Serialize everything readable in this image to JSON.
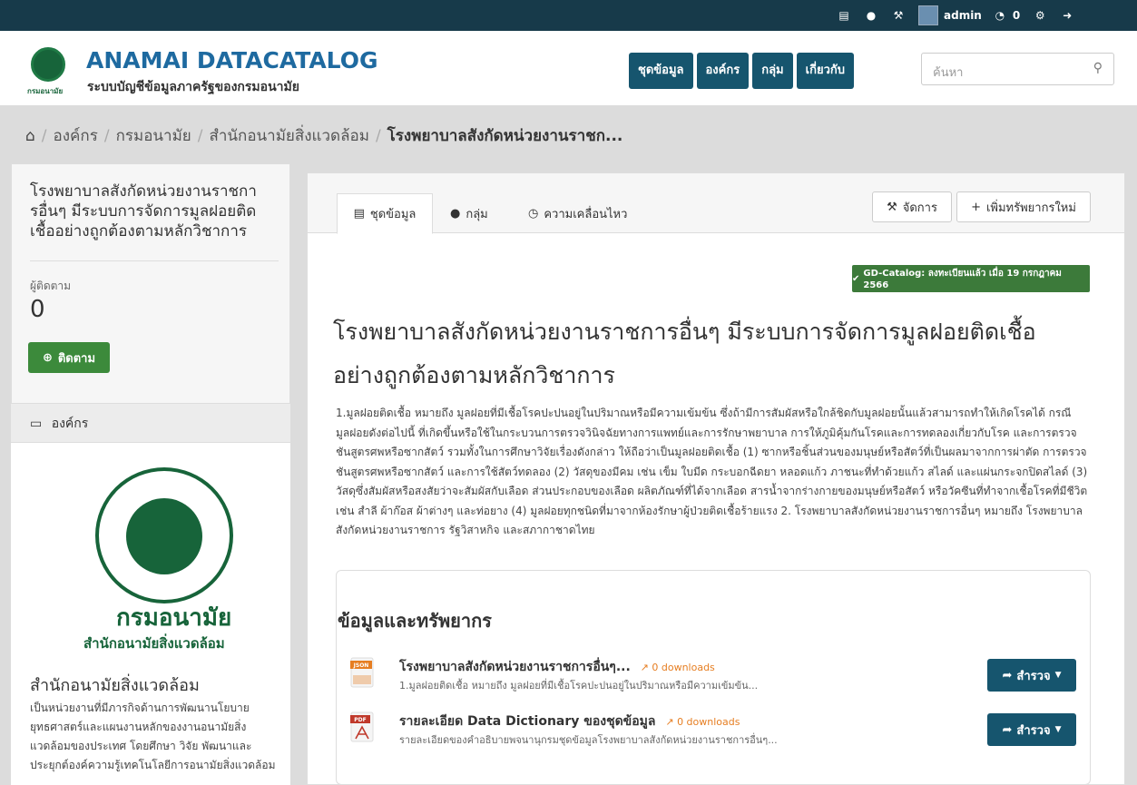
{
  "topbar": {
    "username": "admin",
    "dashboard_count": "0"
  },
  "site": {
    "title": "ANAMAI DATACATALOG",
    "subtitle": "ระบบบัญชีข้อมูลภาครัฐของกรมอนามัย",
    "logo_text": "กรมอนามัย"
  },
  "nav": {
    "items": [
      "ชุดข้อมูล",
      "องค์กร",
      "กลุ่ม",
      "เกี่ยวกับ"
    ]
  },
  "search": {
    "placeholder": "ค้นหา"
  },
  "breadcrumb": {
    "items": [
      "องค์กร",
      "กรมอนามัย",
      "สำนักอนามัยสิ่งแวดล้อม",
      "โรงพยาบาลสังกัดหน่วยงานราชก..."
    ]
  },
  "sidebar": {
    "title": "โรงพยาบาลสังกัดหน่วยงานราชการอื่นๆ มีระบบการจัดการมูลฝอยติดเชื้ออย่างถูกต้องตามหลักวิชาการ",
    "followers_label": "ผู้ติดตาม",
    "followers_count": "0",
    "follow_button": "ติดตาม",
    "org_header": "องค์กร",
    "org_logo_big": "กรมอนามัย",
    "org_logo_sub": "สำนักอนามัยสิ่งแวดล้อม",
    "org_name": "สำนักอนามัยสิ่งแวดล้อม",
    "org_description": "เป็นหน่วยงานที่มีภารกิจด้านการพัฒนานโยบาย ยุทธศาสตร์และแผนงานหลักของงานอนามัยสิ่งแวดล้อมของประเทศ โดยศึกษา วิจัย พัฒนาและประยุกต์องค์ความรู้เทคโนโลยีการอนามัยสิ่งแวดล้อม"
  },
  "tabs": {
    "dataset": "ชุดข้อมูล",
    "groups": "กลุ่ม",
    "activity": "ความเคลื่อนไหว"
  },
  "actions": {
    "manage": "จัดการ",
    "add_resource": "เพิ่มทรัพยากรใหม่"
  },
  "badge": "GD-Catalog: ลงทะเบียนแล้ว เมื่อ 19 กรกฎาคม 2566",
  "dataset": {
    "title": "โรงพยาบาลสังกัดหน่วยงานราชการอื่นๆ มีระบบการจัดการมูลฝอยติดเชื้ออย่างถูกต้องตามหลักวิชาการ",
    "notes": "1.มูลฝอยติดเชื้อ หมายถึง มูลฝอยที่มีเชื้อโรคปะปนอยู่ในปริมาณหรือมีความเข้มข้น ซึ่งถ้ามีการสัมผัสหรือใกล้ชิดกับมูลฝอยนั้นแล้วสามารถทำให้เกิดโรคได้ กรณีมูลฝอยดังต่อไปนี้ ที่เกิดขึ้นหรือใช้ในกระบวนการตรวจวินิจฉัยทางการแพทย์และการรักษาพยาบาล การให้ภูมิคุ้มกันโรคและการทดลองเกี่ยวกับโรค และการตรวจชันสูตรศพหรือซากสัตว์ รวมทั้งในการศึกษาวิจัยเรื่องดังกล่าว ให้ถือว่าเป็นมูลฝอยติดเชื้อ (1) ซากหรือชิ้นส่วนของมนุษย์หรือสัตว์ที่เป็นผลมาจากการผ่าตัด การตรวจชันสูตรศพหรือซากสัตว์ และการใช้สัตว์ทดลอง (2) วัสดุของมีคม เช่น เข็ม ใบมีด กระบอกฉีดยา หลอดแก้ว ภาชนะที่ทำด้วยแก้ว สไลด์ และแผ่นกระจกปิดสไลด์ (3) วัสดุซึ่งสัมผัสหรือสงสัยว่าจะสัมผัสกับเลือด ส่วนประกอบของเลือด ผลิตภัณฑ์ที่ได้จากเลือด สารน้ำจากร่างกายของมนุษย์หรือสัตว์ หรือวัคซีนที่ทำจากเชื้อโรคที่มีชีวิต เช่น สำลี ผ้าก๊อส ผ้าต่างๆ และท่อยาง (4) มูลฝอยทุกชนิดที่มาจากห้องรักษาผู้ป่วยติดเชื้อร้ายแรง 2. โรงพยาบาลสังกัดหน่วยงานราชการอื่นๆ หมายถึง โรงพยาบาลสังกัดหน่วยงานราชการ รัฐวิสาหกิจ และสภากาชาดไทย"
  },
  "resources": {
    "heading": "ข้อมูลและทรัพยากร",
    "items": [
      {
        "format": "JSON",
        "title": "โรงพยาบาลสังกัดหน่วยงานราชการอื่นๆ...",
        "downloads": "0 downloads",
        "description": "1.มูลฝอยติดเชื้อ หมายถึง มูลฝอยที่มีเชื้อโรคปะปนอยู่ในปริมาณหรือมีความเข้มข้น...",
        "button": "สำรวจ"
      },
      {
        "format": "PDF",
        "title": "รายละเอียด Data Dictionary ของชุดข้อมูล",
        "downloads": "0 downloads",
        "description": "รายละเอียดของคำอธิบายพจนานุกรมชุดข้อมูลโรงพยาบาลสังกัดหน่วยงานราชการอื่นๆ...",
        "button": "สำรวจ"
      }
    ]
  },
  "colors": {
    "topbar": "#173a4a",
    "nav_button": "#16556e",
    "brand_green": "#17643a",
    "follow_green": "#3c8a3b",
    "downloads": "#e67e22"
  }
}
